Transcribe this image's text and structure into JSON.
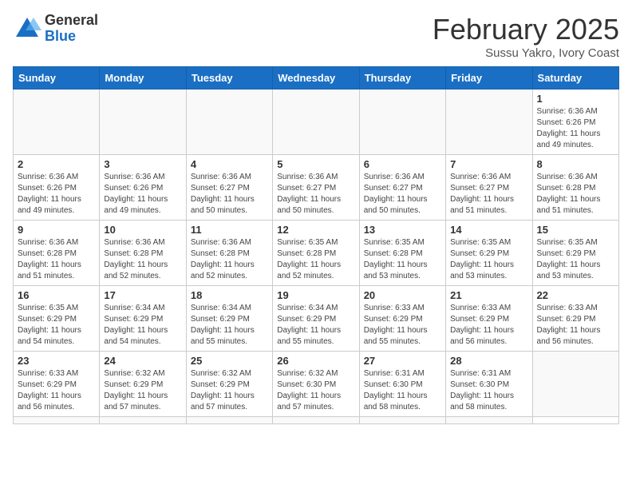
{
  "header": {
    "logo_general": "General",
    "logo_blue": "Blue",
    "month_title": "February 2025",
    "location": "Sussu Yakro, Ivory Coast"
  },
  "weekdays": [
    "Sunday",
    "Monday",
    "Tuesday",
    "Wednesday",
    "Thursday",
    "Friday",
    "Saturday"
  ],
  "days": [
    {
      "date": null
    },
    {
      "date": null
    },
    {
      "date": null
    },
    {
      "date": null
    },
    {
      "date": null
    },
    {
      "date": null
    },
    {
      "date": 1,
      "sunrise": "6:36 AM",
      "sunset": "6:26 PM",
      "daylight": "11 hours and 49 minutes."
    },
    {
      "date": 2,
      "sunrise": "6:36 AM",
      "sunset": "6:26 PM",
      "daylight": "11 hours and 49 minutes."
    },
    {
      "date": 3,
      "sunrise": "6:36 AM",
      "sunset": "6:26 PM",
      "daylight": "11 hours and 49 minutes."
    },
    {
      "date": 4,
      "sunrise": "6:36 AM",
      "sunset": "6:27 PM",
      "daylight": "11 hours and 50 minutes."
    },
    {
      "date": 5,
      "sunrise": "6:36 AM",
      "sunset": "6:27 PM",
      "daylight": "11 hours and 50 minutes."
    },
    {
      "date": 6,
      "sunrise": "6:36 AM",
      "sunset": "6:27 PM",
      "daylight": "11 hours and 50 minutes."
    },
    {
      "date": 7,
      "sunrise": "6:36 AM",
      "sunset": "6:27 PM",
      "daylight": "11 hours and 51 minutes."
    },
    {
      "date": 8,
      "sunrise": "6:36 AM",
      "sunset": "6:28 PM",
      "daylight": "11 hours and 51 minutes."
    },
    {
      "date": 9,
      "sunrise": "6:36 AM",
      "sunset": "6:28 PM",
      "daylight": "11 hours and 51 minutes."
    },
    {
      "date": 10,
      "sunrise": "6:36 AM",
      "sunset": "6:28 PM",
      "daylight": "11 hours and 52 minutes."
    },
    {
      "date": 11,
      "sunrise": "6:36 AM",
      "sunset": "6:28 PM",
      "daylight": "11 hours and 52 minutes."
    },
    {
      "date": 12,
      "sunrise": "6:35 AM",
      "sunset": "6:28 PM",
      "daylight": "11 hours and 52 minutes."
    },
    {
      "date": 13,
      "sunrise": "6:35 AM",
      "sunset": "6:28 PM",
      "daylight": "11 hours and 53 minutes."
    },
    {
      "date": 14,
      "sunrise": "6:35 AM",
      "sunset": "6:29 PM",
      "daylight": "11 hours and 53 minutes."
    },
    {
      "date": 15,
      "sunrise": "6:35 AM",
      "sunset": "6:29 PM",
      "daylight": "11 hours and 53 minutes."
    },
    {
      "date": 16,
      "sunrise": "6:35 AM",
      "sunset": "6:29 PM",
      "daylight": "11 hours and 54 minutes."
    },
    {
      "date": 17,
      "sunrise": "6:34 AM",
      "sunset": "6:29 PM",
      "daylight": "11 hours and 54 minutes."
    },
    {
      "date": 18,
      "sunrise": "6:34 AM",
      "sunset": "6:29 PM",
      "daylight": "11 hours and 55 minutes."
    },
    {
      "date": 19,
      "sunrise": "6:34 AM",
      "sunset": "6:29 PM",
      "daylight": "11 hours and 55 minutes."
    },
    {
      "date": 20,
      "sunrise": "6:33 AM",
      "sunset": "6:29 PM",
      "daylight": "11 hours and 55 minutes."
    },
    {
      "date": 21,
      "sunrise": "6:33 AM",
      "sunset": "6:29 PM",
      "daylight": "11 hours and 56 minutes."
    },
    {
      "date": 22,
      "sunrise": "6:33 AM",
      "sunset": "6:29 PM",
      "daylight": "11 hours and 56 minutes."
    },
    {
      "date": 23,
      "sunrise": "6:33 AM",
      "sunset": "6:29 PM",
      "daylight": "11 hours and 56 minutes."
    },
    {
      "date": 24,
      "sunrise": "6:32 AM",
      "sunset": "6:29 PM",
      "daylight": "11 hours and 57 minutes."
    },
    {
      "date": 25,
      "sunrise": "6:32 AM",
      "sunset": "6:29 PM",
      "daylight": "11 hours and 57 minutes."
    },
    {
      "date": 26,
      "sunrise": "6:32 AM",
      "sunset": "6:30 PM",
      "daylight": "11 hours and 57 minutes."
    },
    {
      "date": 27,
      "sunrise": "6:31 AM",
      "sunset": "6:30 PM",
      "daylight": "11 hours and 58 minutes."
    },
    {
      "date": 28,
      "sunrise": "6:31 AM",
      "sunset": "6:30 PM",
      "daylight": "11 hours and 58 minutes."
    },
    {
      "date": null
    },
    {
      "date": null
    },
    {
      "date": null
    },
    {
      "date": null
    },
    {
      "date": null
    },
    {
      "date": null
    },
    {
      "date": null
    }
  ]
}
